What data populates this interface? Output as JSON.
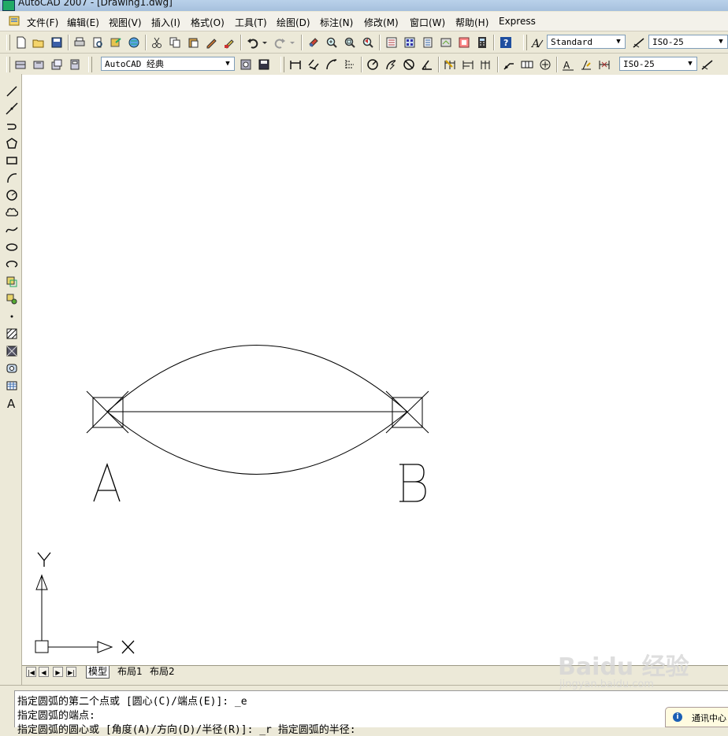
{
  "window": {
    "title": "AutoCAD 2007 - [Drawing1.dwg]"
  },
  "menu": [
    "文件(F)",
    "编辑(E)",
    "视图(V)",
    "插入(I)",
    "格式(O)",
    "工具(T)",
    "绘图(D)",
    "标注(N)",
    "修改(M)",
    "窗口(W)",
    "帮助(H)",
    "Express"
  ],
  "toolbar": {
    "text_style": "Standard",
    "dim_style": "ISO-25",
    "workspace": "AutoCAD 经典",
    "dim_style_2": "ISO-25"
  },
  "drawing": {
    "label_a": "A",
    "label_b": "B",
    "axis_x": "X",
    "axis_y": "Y"
  },
  "tabs": [
    "模型",
    "布局1",
    "布局2"
  ],
  "command": {
    "line1": "指定圆弧的第二个点或 [圆心(C)/端点(E)]: _e",
    "line2": "指定圆弧的端点:",
    "line3": "指定圆弧的圆心或 [角度(A)/方向(D)/半径(R)]: _r 指定圆弧的半径:"
  },
  "status": {
    "comm_center": "通讯中心"
  },
  "watermark": {
    "brand": "Baidu 经验",
    "url": "jingyan.baidu.com"
  }
}
